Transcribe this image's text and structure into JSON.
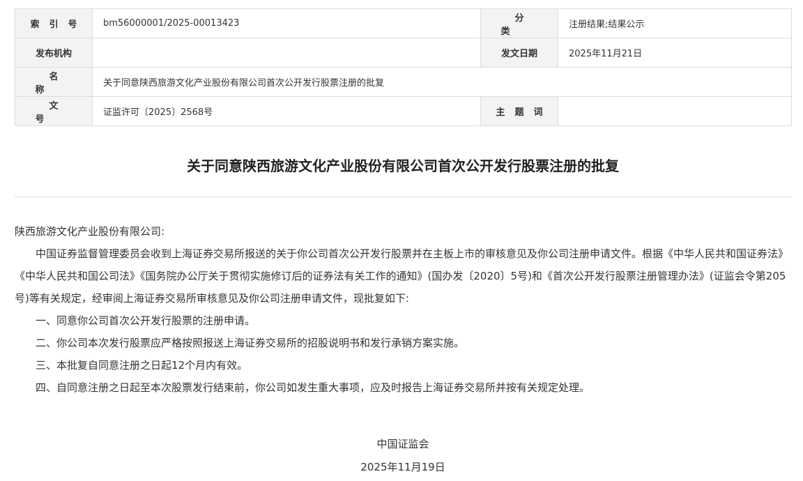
{
  "meta": {
    "index_label": "索引号",
    "index_value": "bm56000001/2025-00013423",
    "category_label": "分类",
    "category_value": "注册结果;结果公示",
    "publisher_label": "发布机构",
    "publisher_value": "",
    "date_label": "发文日期",
    "date_value": "2025年11月21日",
    "name_label": "名称",
    "name_value": "关于同意陕西旅游文化产业股份有限公司首次公开发行股票注册的批复",
    "docno_label": "文号",
    "docno_value": "证监许可〔2025〕2568号",
    "subject_label": "主题词",
    "subject_value": ""
  },
  "document": {
    "title": "关于同意陕西旅游文化产业股份有限公司首次公开发行股票注册的批复",
    "addressee": "陕西旅游文化产业股份有限公司:",
    "paragraph_1": "中国证券监督管理委员会收到上海证券交易所报送的关于你公司首次公开发行股票并在主板上市的审核意见及你公司注册申请文件。根据《中华人民共和国证券法》《中华人民共和国公司法》《国务院办公厅关于贯彻实施修订后的证券法有关工作的通知》(国办发〔2020〕5号)和《首次公开发行股票注册管理办法》(证监会令第205号)等有关规定，经审阅上海证券交易所审核意见及你公司注册申请文件，现批复如下:",
    "item_1": "一、同意你公司首次公开发行股票的注册申请。",
    "item_2": "二、你公司本次发行股票应严格按照报送上海证券交易所的招股说明书和发行承销方案实施。",
    "item_3": "三、本批复自同意注册之日起12个月内有效。",
    "item_4": "四、自同意注册之日起至本次股票发行结束前，你公司如发生重大事项，应及时报告上海证券交易所并按有关规定处理。",
    "signature": "中国证监会",
    "sign_date": "2025年11月19日"
  }
}
